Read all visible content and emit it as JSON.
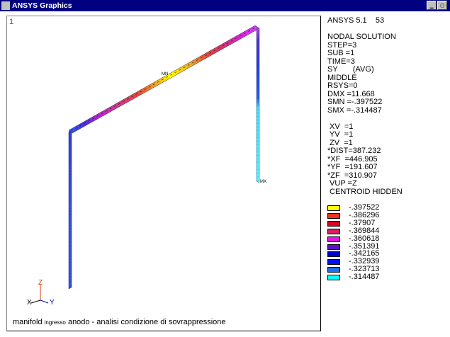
{
  "window": {
    "title": "ANSYS Graphics",
    "minimize_glyph": "▁",
    "maximize_glyph": "▢"
  },
  "viewport": {
    "window_number": "1",
    "node_labels": {
      "mn": "MN",
      "mx": "MX"
    },
    "triad_labels": {
      "x": "X",
      "y": "Y",
      "z": "Z"
    },
    "caption_main": "manifold ",
    "caption_small": "ingresso",
    "caption_rest": " anodo - analisi condizione di sovrappressione"
  },
  "info_lines": [
    "ANSYS 5.1    53",
    "",
    "NODAL SOLUTION",
    "STEP=3",
    "SUB =1",
    "TIME=3",
    "SY       (AVG)",
    "MIDDLE",
    "RSYS=0",
    "DMX =11.668",
    "SMN =-.397522",
    "SMX =-.314487",
    "",
    " XV  =1",
    " YV  =1",
    " ZV  =1",
    "*DIST=387.232",
    "*XF  =446.905",
    "*YF  =191.607",
    "*ZF  =310.907",
    " VUP =Z",
    " CENTROID HIDDEN"
  ],
  "legend": [
    {
      "color": "#ffff00",
      "label": "-.397522"
    },
    {
      "color": "#ee3020",
      "label": "-.386296"
    },
    {
      "color": "#dd0020",
      "label": "-.37907"
    },
    {
      "color": "#dd2060",
      "label": "-.369844"
    },
    {
      "color": "#ee10ee",
      "label": "-.360618"
    },
    {
      "color": "#6010cc",
      "label": "-.351391"
    },
    {
      "color": "#0000cc",
      "label": "-.342165"
    },
    {
      "color": "#0010ee",
      "label": "-.332939"
    },
    {
      "color": "#2070ee",
      "label": "-.323713"
    },
    {
      "color": "#00ffff",
      "label": "-.314487"
    }
  ]
}
